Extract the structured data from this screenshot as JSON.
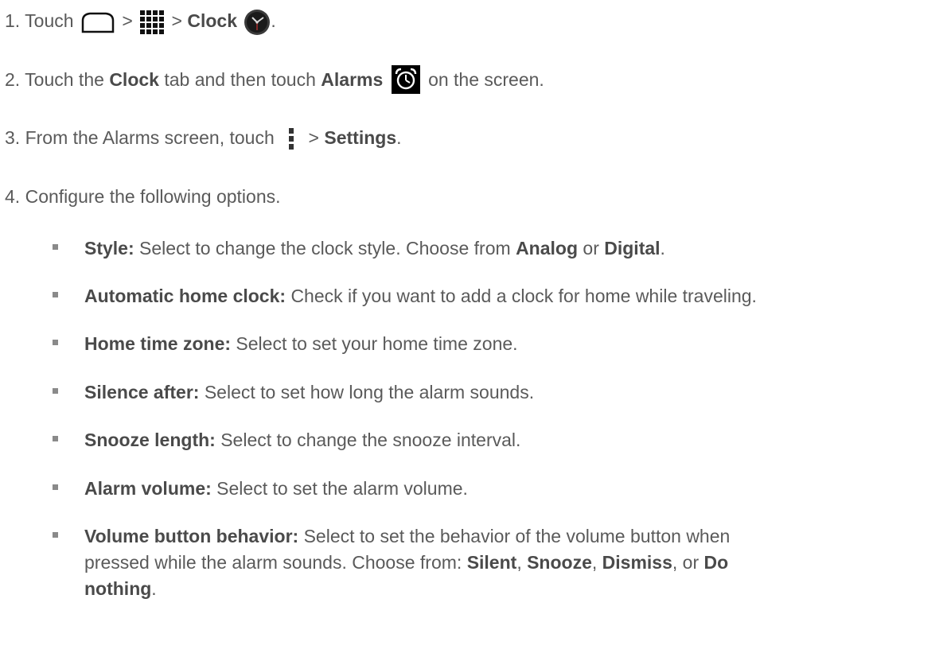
{
  "steps": [
    {
      "num": "1.",
      "touch": "Touch",
      "sep1": ">",
      "sep2": ">",
      "clock": "Clock",
      "end": "."
    },
    {
      "num": "2.",
      "pre": "Touch the",
      "clock": "Clock",
      "mid": "tab and then touch",
      "alarms": "Alarms",
      "post": "on the screen."
    },
    {
      "num": "3.",
      "pre": "From the Alarms screen, touch",
      "sep": ">",
      "settings": "Settings",
      "end": "."
    },
    {
      "num": "4.",
      "text": "Configure the following options."
    }
  ],
  "options": [
    {
      "label": "Style:",
      "text": "Select to change the clock style. Choose from",
      "a": "Analog",
      "or": "or",
      "b": "Digital",
      "end": "."
    },
    {
      "label": "Automatic home clock:",
      "text": "Check if you want to add a clock for home while traveling."
    },
    {
      "label": "Home time zone:",
      "text": "Select to set your home time zone."
    },
    {
      "label": "Silence after:",
      "text": "Select to set how long the alarm sounds."
    },
    {
      "label": "Snooze length:",
      "text": "Select to change the snooze interval."
    },
    {
      "label": "Alarm volume:",
      "text": "Select to set the alarm volume."
    },
    {
      "label": "Volume button behavior:",
      "text": "Select to set the behavior of the volume button when",
      "line2": "pressed while the alarm sounds. Choose from:",
      "c1": "Silent",
      "comma1": ",",
      "c2": "Snooze",
      "comma2": ",",
      "c3": "Dismiss",
      "comma3": ", or",
      "c4": "Do",
      "line3": "nothing",
      "end": "."
    }
  ],
  "icons": {
    "home": "home-icon",
    "apps": "apps-grid-icon",
    "clock": "clock-app-icon",
    "alarm": "alarm-clock-icon",
    "menu": "overflow-menu-icon"
  }
}
